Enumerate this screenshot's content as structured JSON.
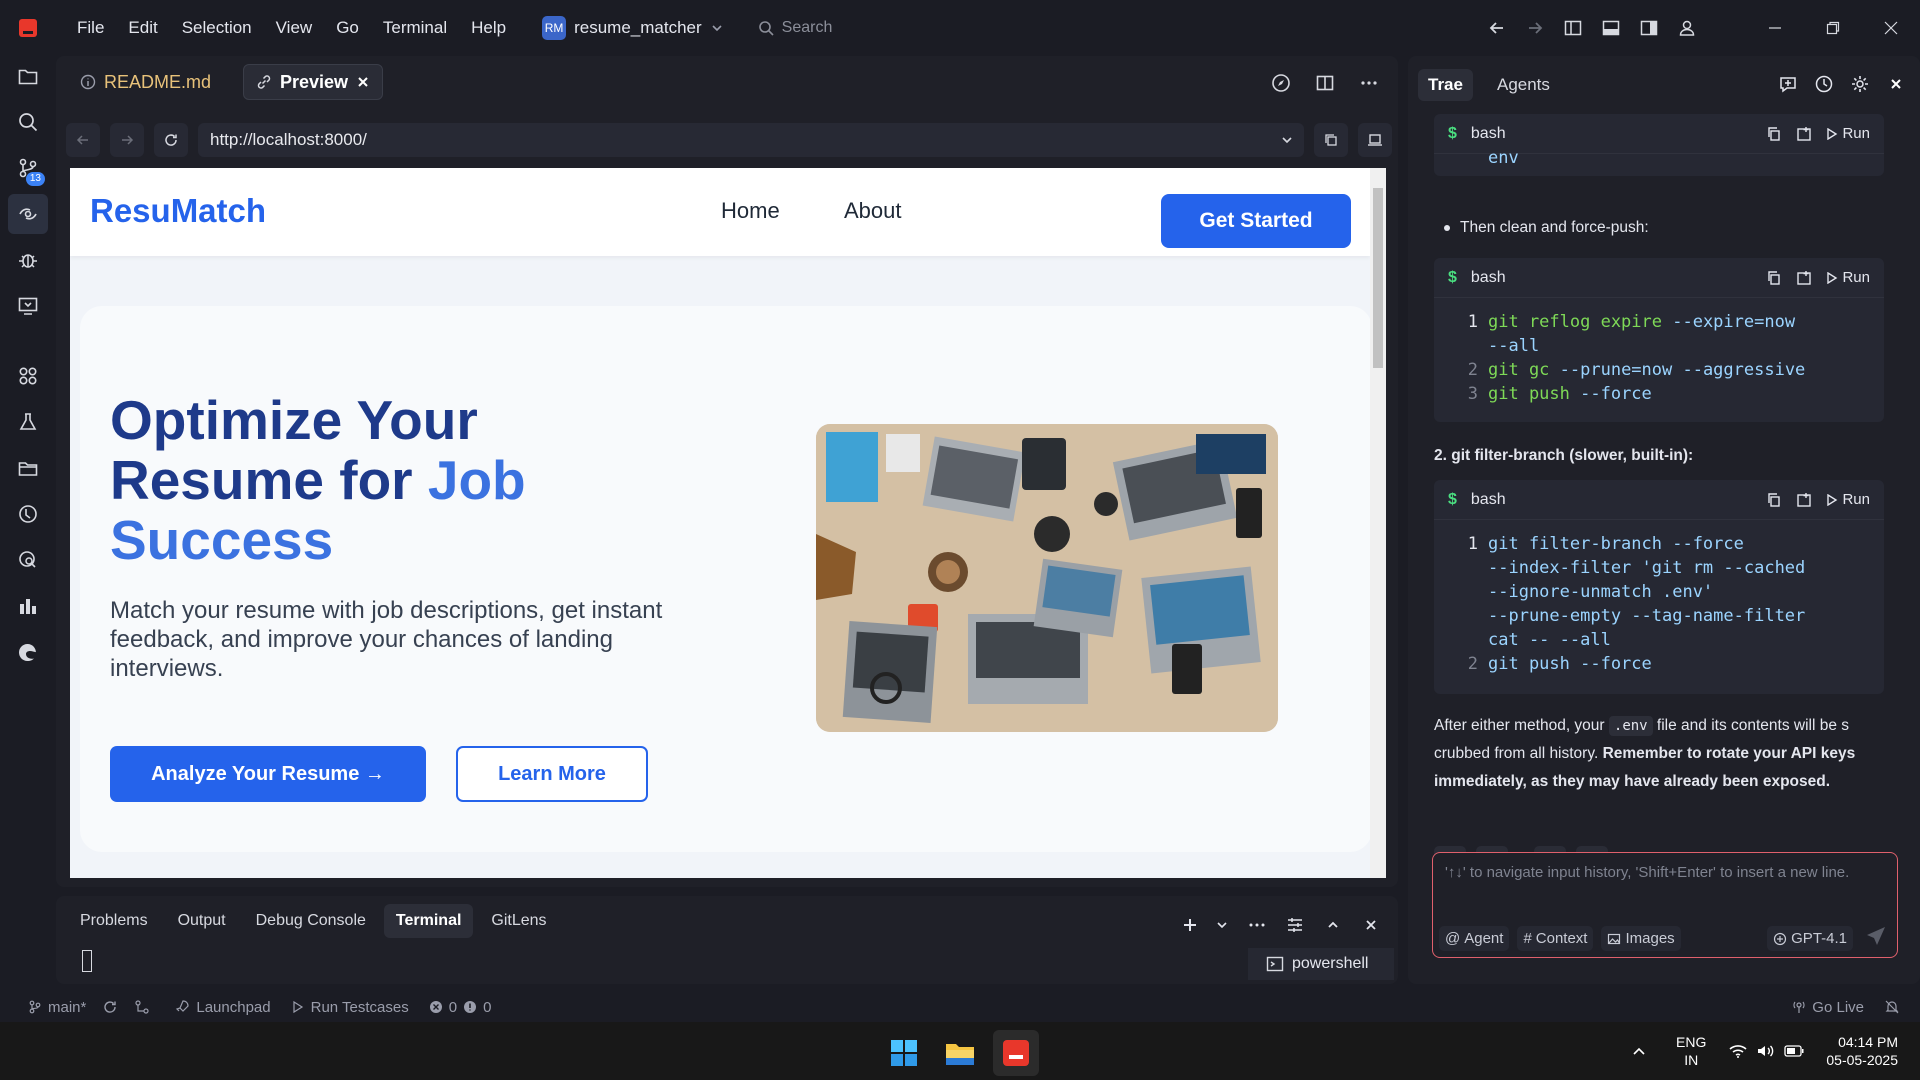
{
  "titlebar": {
    "menu": [
      "File",
      "Edit",
      "Selection",
      "View",
      "Go",
      "Terminal",
      "Help"
    ],
    "project_badge": "RM",
    "project_name": "resume_matcher",
    "search_placeholder": "Search"
  },
  "activity": {
    "scm_badge": "13"
  },
  "editor": {
    "tabs": [
      {
        "label": "README.md",
        "icon": "info-icon"
      },
      {
        "label": "Preview",
        "icon": "link-icon"
      }
    ],
    "url": "http://localhost:8000/"
  },
  "site": {
    "logo": "ResuMatch",
    "nav": [
      "Home",
      "About"
    ],
    "cta": "Get Started",
    "hero_title_line1": "Optimize Your",
    "hero_title_line2a": "Resume for ",
    "hero_title_line2b": "Job",
    "hero_title_line3": "Success",
    "hero_sub": "Match your resume with job descriptions, get instant feedback, and improve your chances of landing interviews.",
    "primary_button": "Analyze Your Resume →",
    "secondary_button": "Learn More",
    "colors": {
      "primary": "#2563eb",
      "title": "#1e3a8a"
    }
  },
  "bottom_panel": {
    "tabs": [
      "Problems",
      "Output",
      "Debug Console",
      "Terminal",
      "GitLens"
    ],
    "active_tab": "Terminal",
    "terminal_name": "powershell"
  },
  "chat": {
    "tabs": [
      "Trae",
      "Agents"
    ],
    "code_lang": "bash",
    "copy_label": "",
    "run_label": "Run",
    "block1_tail": "env",
    "bullet_text": "Then clean and force-push:",
    "block2": [
      {
        "n": "1",
        "cmd": "git reflog expire",
        "rest": " --expire=now"
      },
      {
        "n": "",
        "cmd": "",
        "rest": "--all"
      },
      {
        "n": "2",
        "cmd": "git gc",
        "rest": " --prune=now --aggressive"
      },
      {
        "n": "3",
        "cmd": "git push",
        "rest": " --force"
      }
    ],
    "heading": "2. git filter-branch (slower, built-in):",
    "block3": [
      {
        "n": "1",
        "text": "git filter-branch --force"
      },
      {
        "n": "",
        "text": "--index-filter 'git rm --cached"
      },
      {
        "n": "",
        "text": "--ignore-unmatch .env'"
      },
      {
        "n": "",
        "text": "--prune-empty --tag-name-filter"
      },
      {
        "n": "",
        "text": "cat -- --all"
      },
      {
        "n": "2",
        "text": "git push --force"
      }
    ],
    "after_text_1": "After either method, your ",
    "after_code": ".env",
    "after_text_2": " file and its contents will be s",
    "after_text_3": "crubbed from all history. ",
    "after_bold": "Remember to rotate your API keys immediately, as they may have already been exposed.",
    "input_placeholder": "'↑↓' to navigate input history, 'Shift+Enter' to insert a new line.",
    "chips": [
      "Agent",
      "Context",
      "Images"
    ],
    "model": "GPT-4.1"
  },
  "statusbar": {
    "branch": "main*",
    "launchpad": "Launchpad",
    "run_testcases": "Run Testcases",
    "errors": "0",
    "warnings": "0",
    "go_live": "Go Live"
  },
  "taskbar": {
    "lang1": "ENG",
    "lang2": "IN",
    "time": "04:14 PM",
    "date": "05-05-2025"
  }
}
